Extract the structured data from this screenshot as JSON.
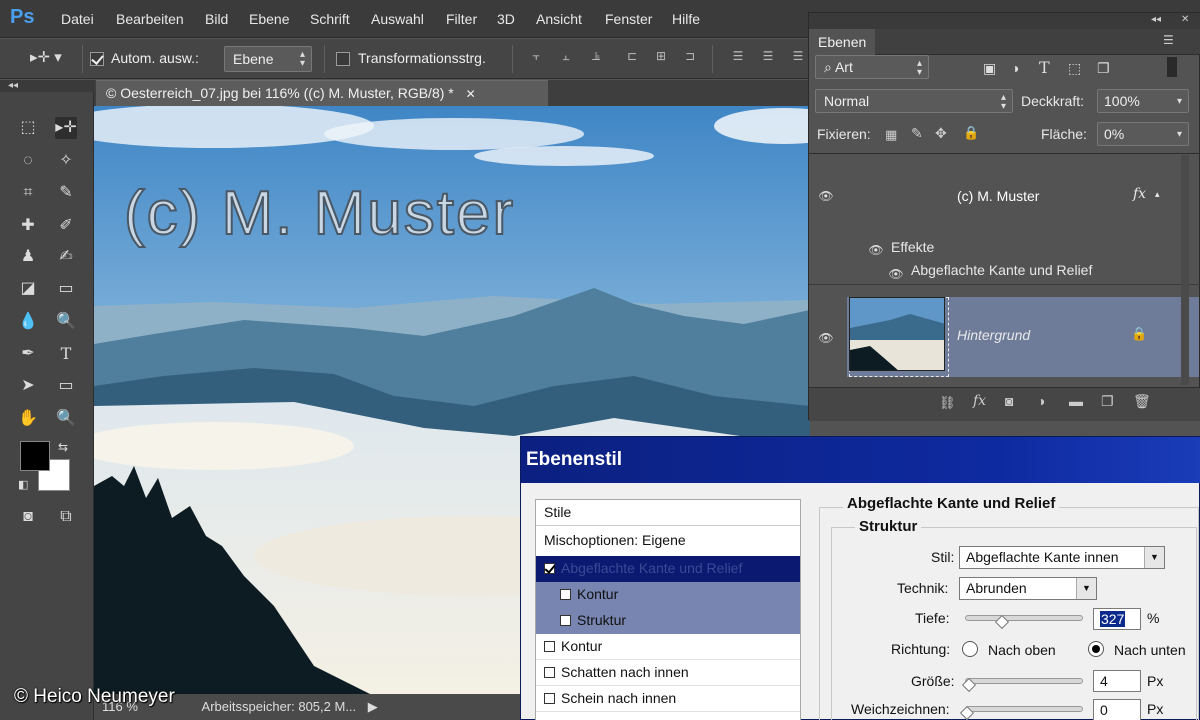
{
  "app": {
    "logo": "Ps"
  },
  "menu": [
    "Datei",
    "Bearbeiten",
    "Bild",
    "Ebene",
    "Schrift",
    "Auswahl",
    "Filter",
    "3D",
    "Ansicht",
    "Fenster",
    "Hilfe"
  ],
  "options": {
    "auto_select_label": "Autom. ausw.:",
    "auto_select_checked": true,
    "auto_select_value": "Ebene",
    "transform_label": "Transformationsstrg.",
    "transform_checked": false
  },
  "document": {
    "tab_title": "© Oesterreich_07.jpg bei 116% ((c) M. Muster, RGB/8) *",
    "watermark_text": "(c) M. Muster",
    "status_zoom": "116 %",
    "status_info": "Arbeitsspeicher: 805,2 M..."
  },
  "credit": "© Heico Neumeyer",
  "layers_panel": {
    "tab": "Ebenen",
    "filter_kind": "Art",
    "blend_mode": "Normal",
    "opacity_label": "Deckkraft:",
    "opacity_value": "100%",
    "lock_label": "Fixieren:",
    "fill_label": "Fläche:",
    "fill_value": "0%",
    "layers": [
      {
        "name": "(c) M. Muster",
        "type": "text",
        "fx": "fx",
        "effects_label": "Effekte",
        "effects": [
          "Abgeflachte Kante und Relief"
        ],
        "selected": true
      },
      {
        "name": "Hintergrund",
        "type": "image",
        "locked": true
      }
    ]
  },
  "dialog": {
    "title": "Ebenenstil",
    "styles": [
      {
        "label": "Stile",
        "checkbox": false
      },
      {
        "label": "Mischoptionen: Eigene",
        "checkbox": false
      },
      {
        "label": "Abgeflachte Kante und Relief",
        "checkbox": true,
        "checked": true,
        "selected": true
      },
      {
        "label": "Kontur",
        "checkbox": true,
        "checked": false,
        "sub": true
      },
      {
        "label": "Struktur",
        "checkbox": true,
        "checked": false,
        "sub": true
      },
      {
        "label": "Kontur",
        "checkbox": true,
        "checked": false
      },
      {
        "label": "Schatten nach innen",
        "checkbox": true,
        "checked": false
      },
      {
        "label": "Schein nach innen",
        "checkbox": true,
        "checked": false
      }
    ],
    "section_title": "Abgeflachte Kante und Relief",
    "group_title": "Struktur",
    "style_label": "Stil:",
    "style_value": "Abgeflachte Kante innen",
    "technique_label": "Technik:",
    "technique_value": "Abrunden",
    "depth_label": "Tiefe:",
    "depth_value": "327",
    "depth_unit": "%",
    "direction_label": "Richtung:",
    "direction_up": "Nach oben",
    "direction_down": "Nach unten",
    "direction_selected": "down",
    "size_label": "Größe:",
    "size_value": "4",
    "size_unit": "Px",
    "soften_label": "Weichzeichnen:",
    "soften_value": "0",
    "soften_unit": "Px"
  }
}
